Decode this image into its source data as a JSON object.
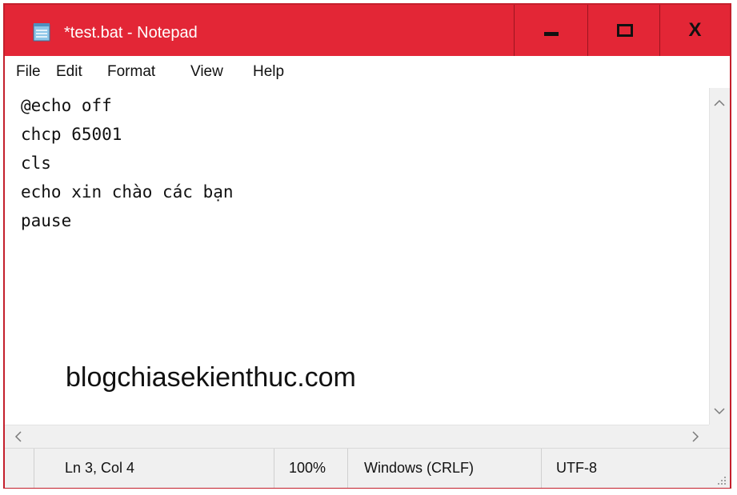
{
  "window": {
    "title": "*test.bat - Notepad",
    "icon": "notepad-icon",
    "accent_color": "#e32636",
    "controls": {
      "minimize": "minimize-icon",
      "maximize": "maximize-icon",
      "close": "X"
    }
  },
  "menu": {
    "items": [
      "File",
      "Edit",
      "Format",
      "View",
      "Help"
    ]
  },
  "editor": {
    "lines": [
      "@echo off",
      "chcp 65001",
      "cls",
      "echo xin chào các bạn",
      "pause"
    ],
    "watermark": "blogchiasekienthuc.com"
  },
  "scrollbars": {
    "up": "chevron-up-icon",
    "down": "chevron-down-icon",
    "left": "chevron-left-icon",
    "right": "chevron-right-icon"
  },
  "status": {
    "position": "Ln 3, Col 4",
    "zoom": "100%",
    "line_ending": "Windows (CRLF)",
    "encoding": "UTF-8"
  }
}
